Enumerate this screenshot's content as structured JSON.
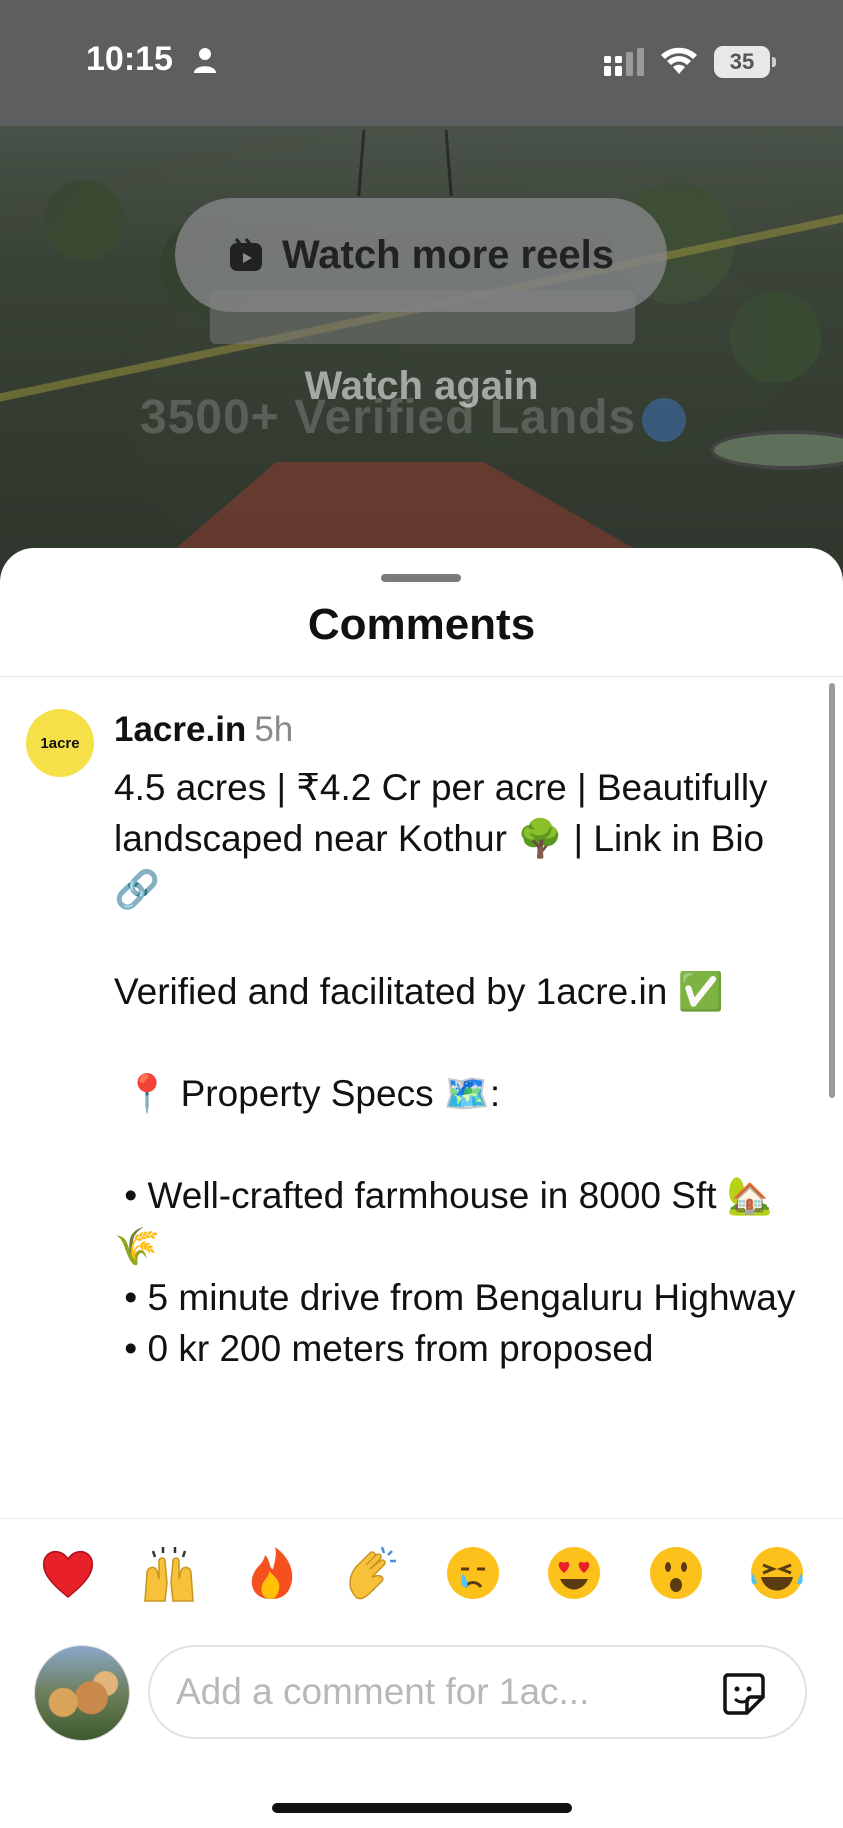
{
  "status_bar": {
    "time": "10:15",
    "battery": "35"
  },
  "video": {
    "watch_more_label": "Watch more reels",
    "watch_again_label": "Watch again",
    "overlay_text": "3500+ Verified Lands"
  },
  "comments_sheet": {
    "title": "Comments",
    "comment": {
      "avatar_text": "1acre",
      "username": "1acre.in",
      "time": "5h",
      "text": "4.5 acres | ₹4.2 Cr per acre | Beautifully landscaped near Kothur 🌳 | Link in Bio 🔗\n\nVerified and facilitated by 1acre.in ✅\n\n 📍 Property Specs 🗺️:\n\n • Well-crafted farmhouse in 8000 Sft 🏡 🌾\n • 5 minute drive from Bengaluru Highway\n • 0 kr 200 meters from proposed"
    }
  },
  "reactions": [
    {
      "emoji": "❤️",
      "name": "heart"
    },
    {
      "emoji": "🙌",
      "name": "raising-hands"
    },
    {
      "emoji": "🔥",
      "name": "fire"
    },
    {
      "emoji": "👏",
      "name": "clapping"
    },
    {
      "emoji": "😢",
      "name": "crying"
    },
    {
      "emoji": "😍",
      "name": "heart-eyes"
    },
    {
      "emoji": "😮",
      "name": "surprised"
    },
    {
      "emoji": "😂",
      "name": "laughing"
    }
  ],
  "composer": {
    "placeholder": "Add a comment for 1ac..."
  },
  "colors": {
    "avatar_yellow": "#f6e04a",
    "sheet_background": "#ffffff",
    "status_bar": "#5c5e60"
  }
}
